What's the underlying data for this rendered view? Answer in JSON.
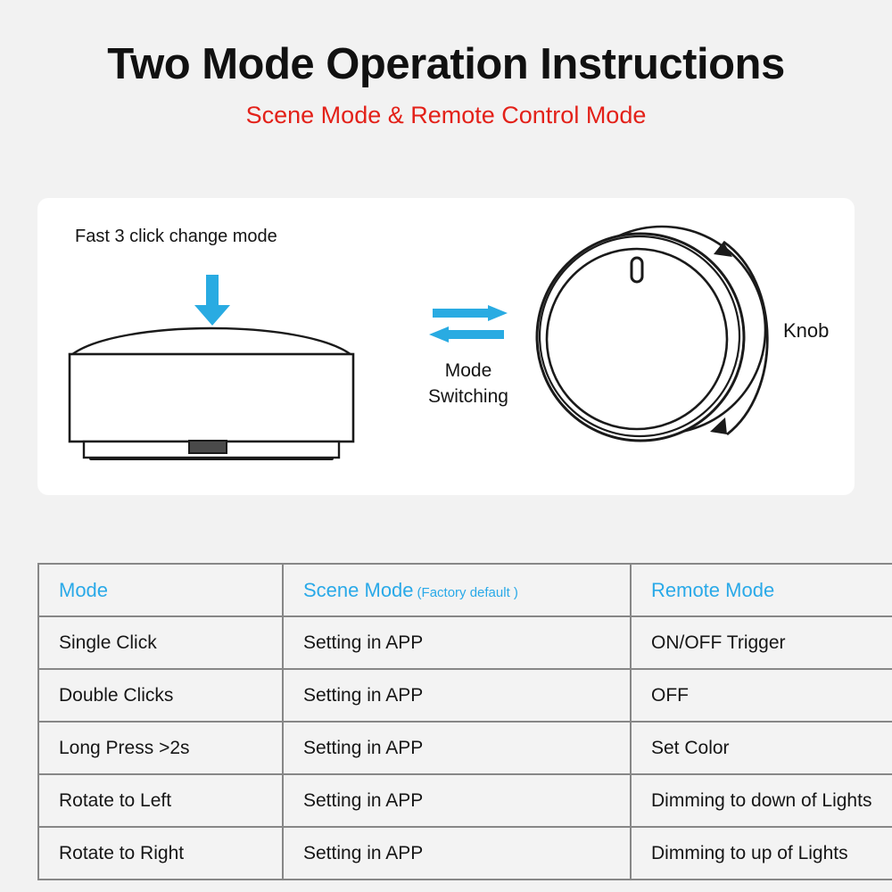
{
  "header": {
    "title": "Two Mode Operation Instructions",
    "subtitle": "Scene Mode & Remote Control Mode",
    "title_color": "#111111",
    "subtitle_color": "#e32119"
  },
  "diagram": {
    "device": {
      "label": "Fast 3 click change mode",
      "arrow_icon": "down-arrow-icon",
      "arrow_color": "#29abe2",
      "device_icon": "smart-knob-side-view-icon"
    },
    "mode_switching": {
      "arrows_icon": "left-right-arrows-icon",
      "arrow_color": "#29abe2",
      "label_line1": "Mode",
      "label_line2": "Switching"
    },
    "knob": {
      "knob_icon": "rotary-knob-icon",
      "indicator_icon": "knob-indicator-mark-icon",
      "rotation_arrow_icon": "double-headed-curved-arrow-icon",
      "label": "Knob"
    }
  },
  "table": {
    "accent_color": "#29a9e8",
    "border_color": "#878787",
    "headers": {
      "mode": "Mode",
      "scene": "Scene Mode",
      "scene_note": "(Factory default )",
      "remote": "Remote Mode"
    },
    "rows": [
      {
        "mode": "Single Click",
        "scene": "Setting in APP",
        "remote": "ON/OFF Trigger"
      },
      {
        "mode": "Double Clicks",
        "scene": "Setting in APP",
        "remote": "OFF"
      },
      {
        "mode": "Long Press >2s",
        "scene": "Setting in APP",
        "remote": "Set Color"
      },
      {
        "mode": "Rotate to Left",
        "scene": "Setting in APP",
        "remote": "Dimming to down of Lights"
      },
      {
        "mode": "Rotate to Right",
        "scene": "Setting in APP",
        "remote": "Dimming to up of Lights"
      }
    ]
  }
}
